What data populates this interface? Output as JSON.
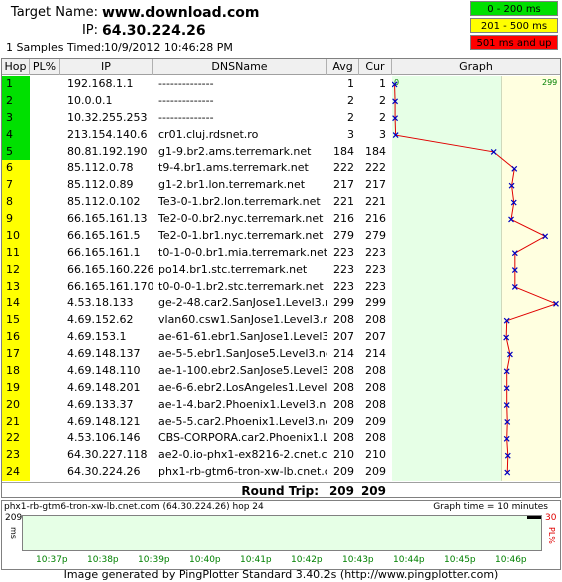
{
  "header": {
    "target_label": "Target Name:",
    "target_value": "www.download.com",
    "ip_label": "IP:",
    "ip_value": "64.30.224.26",
    "samples_label": "1 Samples Timed:",
    "samples_value": "10/9/2012 10:46:28 PM"
  },
  "legend": [
    {
      "label": "0 - 200 ms",
      "bg": "#00e000",
      "fg": "#000000"
    },
    {
      "label": "201 - 500 ms",
      "bg": "#ffff00",
      "fg": "#000000"
    },
    {
      "label": "501 ms and up",
      "bg": "#ff0000",
      "fg": "#000000"
    }
  ],
  "columns": {
    "hop": "Hop",
    "pl": "PL%",
    "ip": "IP",
    "dns": "DNSName",
    "avg": "Avg",
    "cur": "Cur",
    "graph": "Graph"
  },
  "graph_scale": {
    "min_label": "0",
    "max_label": "299",
    "max_value": 299
  },
  "colors": {
    "green": "#00e000",
    "yellow": "#ffff00",
    "graph_green": "#e6ffe6",
    "graph_yellow": "#ffffe0",
    "line": "#e00000",
    "marker": "#0000c0"
  },
  "rows": [
    {
      "hop": "1",
      "pl": "",
      "ip": "192.168.1.1",
      "dns": "--------------",
      "avg": "1",
      "cur": "1",
      "color": "green",
      "value": 1
    },
    {
      "hop": "2",
      "pl": "",
      "ip": "10.0.0.1",
      "dns": "--------------",
      "avg": "2",
      "cur": "2",
      "color": "green",
      "value": 2
    },
    {
      "hop": "3",
      "pl": "",
      "ip": "10.32.255.253",
      "dns": "--------------",
      "avg": "2",
      "cur": "2",
      "color": "green",
      "value": 2
    },
    {
      "hop": "4",
      "pl": "",
      "ip": "213.154.140.6",
      "dns": "cr01.cluj.rdsnet.ro",
      "avg": "3",
      "cur": "3",
      "color": "green",
      "value": 3
    },
    {
      "hop": "5",
      "pl": "",
      "ip": "80.81.192.190",
      "dns": "g1-9.br2.ams.terremark.net",
      "avg": "184",
      "cur": "184",
      "color": "green",
      "value": 184
    },
    {
      "hop": "6",
      "pl": "",
      "ip": "85.112.0.78",
      "dns": "t9-4.br1.ams.terremark.net",
      "avg": "222",
      "cur": "222",
      "color": "yellow",
      "value": 222
    },
    {
      "hop": "7",
      "pl": "",
      "ip": "85.112.0.89",
      "dns": "g1-2.br1.lon.terremark.net",
      "avg": "217",
      "cur": "217",
      "color": "yellow",
      "value": 217
    },
    {
      "hop": "8",
      "pl": "",
      "ip": "85.112.0.102",
      "dns": "Te3-0-1.br2.lon.terremark.net",
      "avg": "221",
      "cur": "221",
      "color": "yellow",
      "value": 221
    },
    {
      "hop": "9",
      "pl": "",
      "ip": "66.165.161.13",
      "dns": "Te2-0-0.br2.nyc.terremark.net",
      "avg": "216",
      "cur": "216",
      "color": "yellow",
      "value": 216
    },
    {
      "hop": "10",
      "pl": "",
      "ip": "66.165.161.5",
      "dns": "Te2-0-1.br1.nyc.terremark.net",
      "avg": "279",
      "cur": "279",
      "color": "yellow",
      "value": 279
    },
    {
      "hop": "11",
      "pl": "",
      "ip": "66.165.161.1",
      "dns": "t0-1-0-0.br1.mia.terremark.net",
      "avg": "223",
      "cur": "223",
      "color": "yellow",
      "value": 223
    },
    {
      "hop": "12",
      "pl": "",
      "ip": "66.165.160.226",
      "dns": "po14.br1.stc.terremark.net",
      "avg": "223",
      "cur": "223",
      "color": "yellow",
      "value": 223
    },
    {
      "hop": "13",
      "pl": "",
      "ip": "66.165.161.170",
      "dns": "t0-0-0-1.br2.stc.terremark.net",
      "avg": "223",
      "cur": "223",
      "color": "yellow",
      "value": 223
    },
    {
      "hop": "14",
      "pl": "",
      "ip": "4.53.18.133",
      "dns": "ge-2-48.car2.SanJose1.Level3.net",
      "avg": "299",
      "cur": "299",
      "color": "yellow",
      "value": 299
    },
    {
      "hop": "15",
      "pl": "",
      "ip": "4.69.152.62",
      "dns": "vlan60.csw1.SanJose1.Level3.net",
      "avg": "208",
      "cur": "208",
      "color": "yellow",
      "value": 208
    },
    {
      "hop": "16",
      "pl": "",
      "ip": "4.69.153.1",
      "dns": "ae-61-61.ebr1.SanJose1.Level3.ne",
      "avg": "207",
      "cur": "207",
      "color": "yellow",
      "value": 207
    },
    {
      "hop": "17",
      "pl": "",
      "ip": "4.69.148.137",
      "dns": "ae-5-5.ebr1.SanJose5.Level3.net",
      "avg": "214",
      "cur": "214",
      "color": "yellow",
      "value": 214
    },
    {
      "hop": "18",
      "pl": "",
      "ip": "4.69.148.110",
      "dns": "ae-1-100.ebr2.SanJose5.Level3.net",
      "avg": "208",
      "cur": "208",
      "color": "yellow",
      "value": 208
    },
    {
      "hop": "19",
      "pl": "",
      "ip": "4.69.148.201",
      "dns": "ae-6-6.ebr2.LosAngeles1.Level3.n",
      "avg": "208",
      "cur": "208",
      "color": "yellow",
      "value": 208
    },
    {
      "hop": "20",
      "pl": "",
      "ip": "4.69.133.37",
      "dns": "ae-1-4.bar2.Phoenix1.Level3.net",
      "avg": "208",
      "cur": "208",
      "color": "yellow",
      "value": 208
    },
    {
      "hop": "21",
      "pl": "",
      "ip": "4.69.148.121",
      "dns": "ae-5-5.car2.Phoenix1.Level3.net",
      "avg": "209",
      "cur": "209",
      "color": "yellow",
      "value": 209
    },
    {
      "hop": "22",
      "pl": "",
      "ip": "4.53.106.146",
      "dns": "CBS-CORPORA.car2.Phoenix1.Lev",
      "avg": "208",
      "cur": "208",
      "color": "yellow",
      "value": 208
    },
    {
      "hop": "23",
      "pl": "",
      "ip": "64.30.227.118",
      "dns": "ae2-0.io-phx1-ex8216-2.cnet.com",
      "avg": "210",
      "cur": "210",
      "color": "yellow",
      "value": 210
    },
    {
      "hop": "24",
      "pl": "",
      "ip": "64.30.224.26",
      "dns": "phx1-rb-gtm6-tron-xw-lb.cnet.co",
      "avg": "209",
      "cur": "209",
      "color": "yellow",
      "value": 209
    }
  ],
  "round_trip": {
    "label": "Round Trip:",
    "avg": "209",
    "cur": "209"
  },
  "bottom": {
    "title": "phx1-rb-gtm6-tron-xw-lb.cnet.com (64.30.224.26) hop 24",
    "graph_time": "Graph time = 10 minutes",
    "y_top": "209",
    "y_unit": "ms",
    "right_top": "30",
    "right_unit": "PL%",
    "times": [
      "10:37p",
      "10:38p",
      "10:39p",
      "10:40p",
      "10:41p",
      "10:42p",
      "10:43p",
      "10:44p",
      "10:45p",
      "10:46p"
    ]
  },
  "footer": "Image generated by PingPlotter Standard 3.40.2s (http://www.pingplotter.com)"
}
